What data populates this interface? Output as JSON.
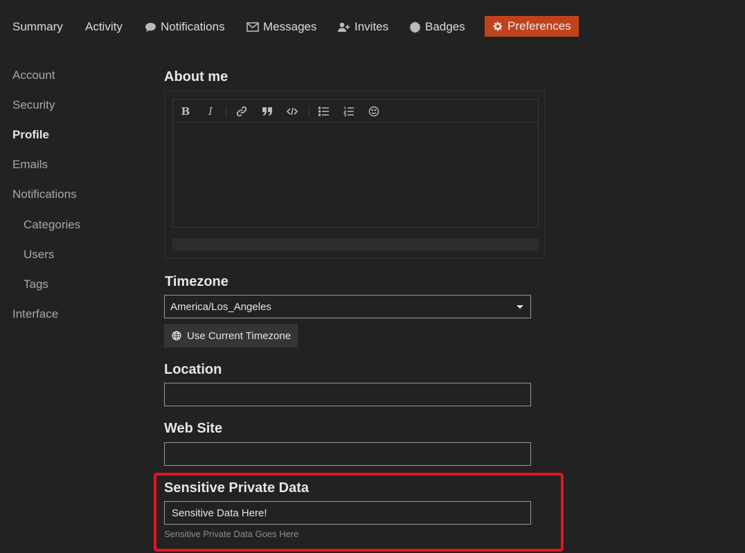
{
  "topnav": {
    "summary": "Summary",
    "activity": "Activity",
    "notifications": "Notifications",
    "messages": "Messages",
    "invites": "Invites",
    "badges": "Badges",
    "preferences": "Preferences"
  },
  "sidenav": {
    "items": [
      "Account",
      "Security",
      "Profile",
      "Emails",
      "Notifications",
      "Categories",
      "Users",
      "Tags",
      "Interface"
    ],
    "active": "Profile"
  },
  "about_me": {
    "label": "About me",
    "toolbar": [
      "bold",
      "italic",
      "link",
      "quote",
      "code",
      "bullet-list",
      "numbered-list",
      "emoji"
    ],
    "value": ""
  },
  "timezone": {
    "label": "Timezone",
    "selected": "America/Los_Angeles",
    "use_current_label": "Use Current Timezone"
  },
  "location": {
    "label": "Location",
    "value": ""
  },
  "website": {
    "label": "Web Site",
    "value": ""
  },
  "sensitive": {
    "label": "Sensitive Private Data",
    "value": "Sensitive Data Here!",
    "hint": "Sensitive Private Data Goes Here"
  },
  "colors": {
    "background": "#222222",
    "accent": "#c0431d",
    "highlight_border": "#e8151b"
  }
}
